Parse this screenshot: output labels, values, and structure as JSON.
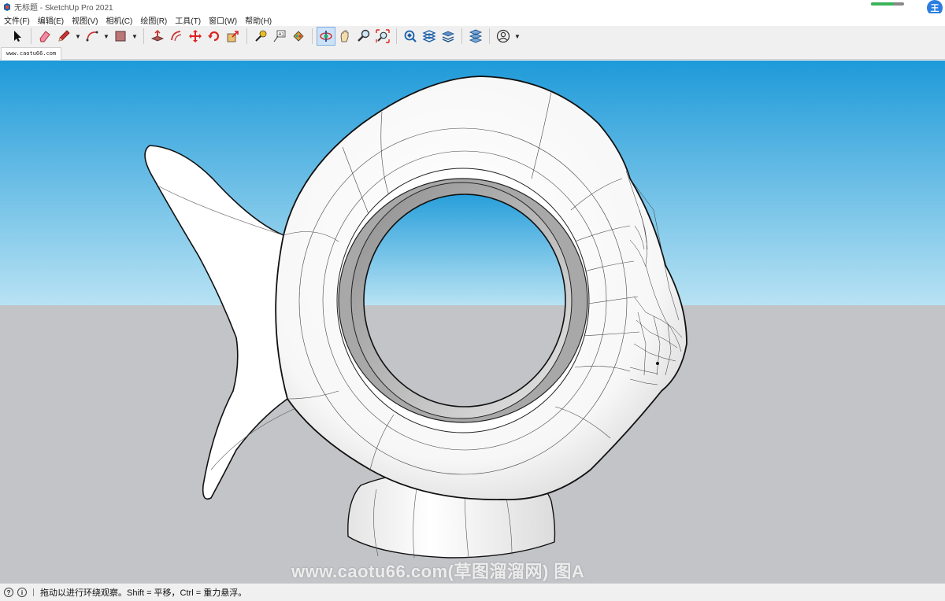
{
  "window": {
    "title": "无标题 - SketchUp Pro 2021",
    "progress_fraction": 0.7,
    "user_badge": "王"
  },
  "menu": {
    "items": [
      "文件(F)",
      "编辑(E)",
      "视图(V)",
      "相机(C)",
      "绘图(R)",
      "工具(T)",
      "窗口(W)",
      "帮助(H)"
    ]
  },
  "toolbar": {
    "tools": [
      "select",
      "eraser",
      "pencil",
      "arc",
      "shape",
      "push-pull",
      "offset",
      "move",
      "rotate",
      "scale",
      "tape-measure",
      "text",
      "paint-bucket",
      "orbit",
      "pan",
      "zoom",
      "zoom-extents",
      "warehouse",
      "extension-warehouse",
      "layout",
      "extension-manager",
      "account"
    ],
    "active_tool": "orbit"
  },
  "scene_tab": {
    "label": "www.caotu66.com"
  },
  "viewport": {
    "sky_color_top": "#1e9ad9",
    "sky_color_bottom": "#b8e2f3",
    "ground_color": "#c3c4c8"
  },
  "watermark": {
    "text": "www.caotu66.com(草图溜溜网) 图A"
  },
  "status": {
    "text": "拖动以进行环绕观察。Shift = 平移，Ctrl = 重力悬浮。"
  }
}
